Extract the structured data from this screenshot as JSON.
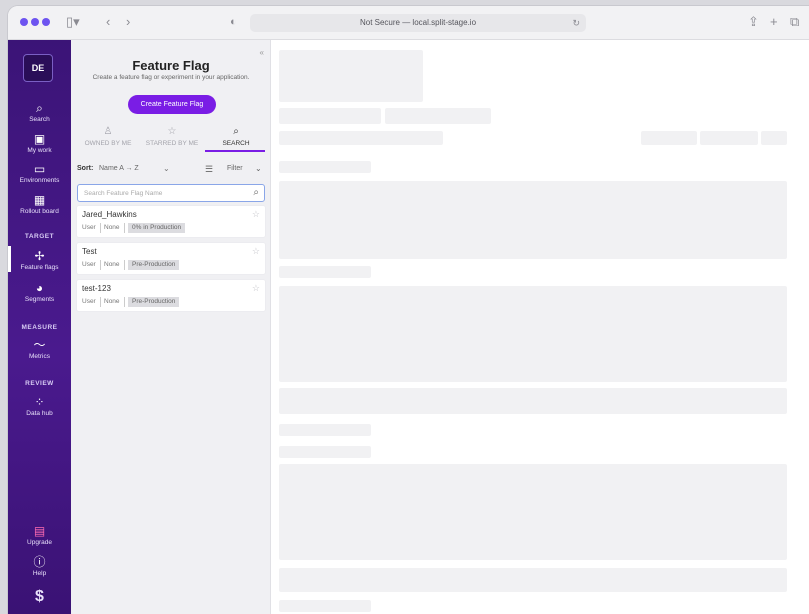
{
  "browser": {
    "url": "Not Secure — local.split-stage.io",
    "icons": [
      "sidebar-toggle-icon",
      "back-icon",
      "forward-icon",
      "shield-icon",
      "reload-icon",
      "share-icon",
      "new-tab-icon",
      "tabs-overview-icon"
    ]
  },
  "nav": {
    "avatar": "DE",
    "items": [
      {
        "label": "Search",
        "icon": "search-icon"
      },
      {
        "label": "My work",
        "icon": "briefcase-icon"
      },
      {
        "label": "Environments",
        "icon": "monitor-icon"
      },
      {
        "label": "Rollout board",
        "icon": "board-icon"
      },
      {
        "label": "Feature flags",
        "icon": "feature-flags-icon"
      },
      {
        "label": "Segments",
        "icon": "segments-icon"
      },
      {
        "label": "Metrics",
        "icon": "metrics-icon"
      },
      {
        "label": "Data hub",
        "icon": "data-hub-icon"
      },
      {
        "label": "Upgrade",
        "icon": "gift-icon"
      },
      {
        "label": "Help",
        "icon": "help-icon"
      }
    ],
    "sections": {
      "target": "TARGET",
      "measure": "MEASURE",
      "review": "REVIEW"
    },
    "logo": "split-logo-icon"
  },
  "panel": {
    "title": "Feature Flag",
    "subtitle": "Create a feature flag or experiment in your application.",
    "create_button": "Create Feature Flag",
    "tabs": [
      {
        "label": "OWNED BY ME",
        "icon": "person-icon",
        "active": false
      },
      {
        "label": "STARRED BY ME",
        "icon": "star-icon",
        "active": false
      },
      {
        "label": "SEARCH",
        "icon": "search-icon",
        "active": true
      }
    ],
    "sort": {
      "label": "Sort:",
      "value": "Name A → Z"
    },
    "filter": {
      "label": "Filter"
    },
    "search": {
      "placeholder": "Search Feature Flag Name",
      "value": ""
    },
    "flags": [
      {
        "name": "Jared_Hawkins",
        "type": "User",
        "owner": "None",
        "status": "0% in Production"
      },
      {
        "name": "Test",
        "type": "User",
        "owner": "None",
        "status": "Pre-Production"
      },
      {
        "name": "test-123",
        "type": "User",
        "owner": "None",
        "status": "Pre-Production"
      }
    ]
  },
  "colors": {
    "nav_bg": "#4a1a8e",
    "accent": "#7a1de5",
    "panel_bg": "#f0f0f3"
  }
}
